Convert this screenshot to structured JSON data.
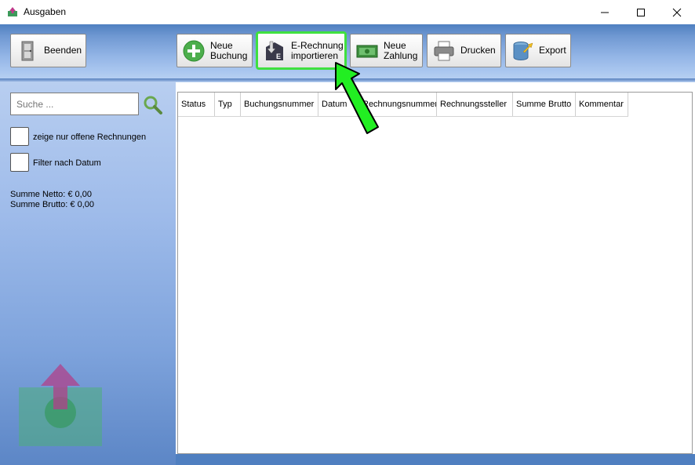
{
  "window": {
    "title": "Ausgaben"
  },
  "toolbar": {
    "quit_label": "Beenden",
    "new_booking_label": "Neue\nBuchung",
    "import_einvoice_label": "E-Rechnung\nimportieren",
    "new_payment_label": "Neue\nZahlung",
    "print_label": "Drucken",
    "export_label": "Export",
    "highlight_color": "#3fe03f"
  },
  "sidebar": {
    "search_placeholder": "Suche ...",
    "filter_open_label": "zeige nur offene Rechnungen",
    "filter_date_label": "Filter nach Datum",
    "sum_net": "Summe Netto: € 0,00",
    "sum_gross": "Summe Brutto: € 0,00"
  },
  "table": {
    "columns": [
      "Status",
      "Typ",
      "Buchungsnummer",
      "Datum",
      "Rechnungsnummer",
      "Rechnungssteller",
      "Summe Brutto",
      "Kommentar"
    ],
    "rows": []
  },
  "colors": {
    "accent_blue": "#4f7fc0",
    "annotation_arrow": "#22ee22"
  }
}
